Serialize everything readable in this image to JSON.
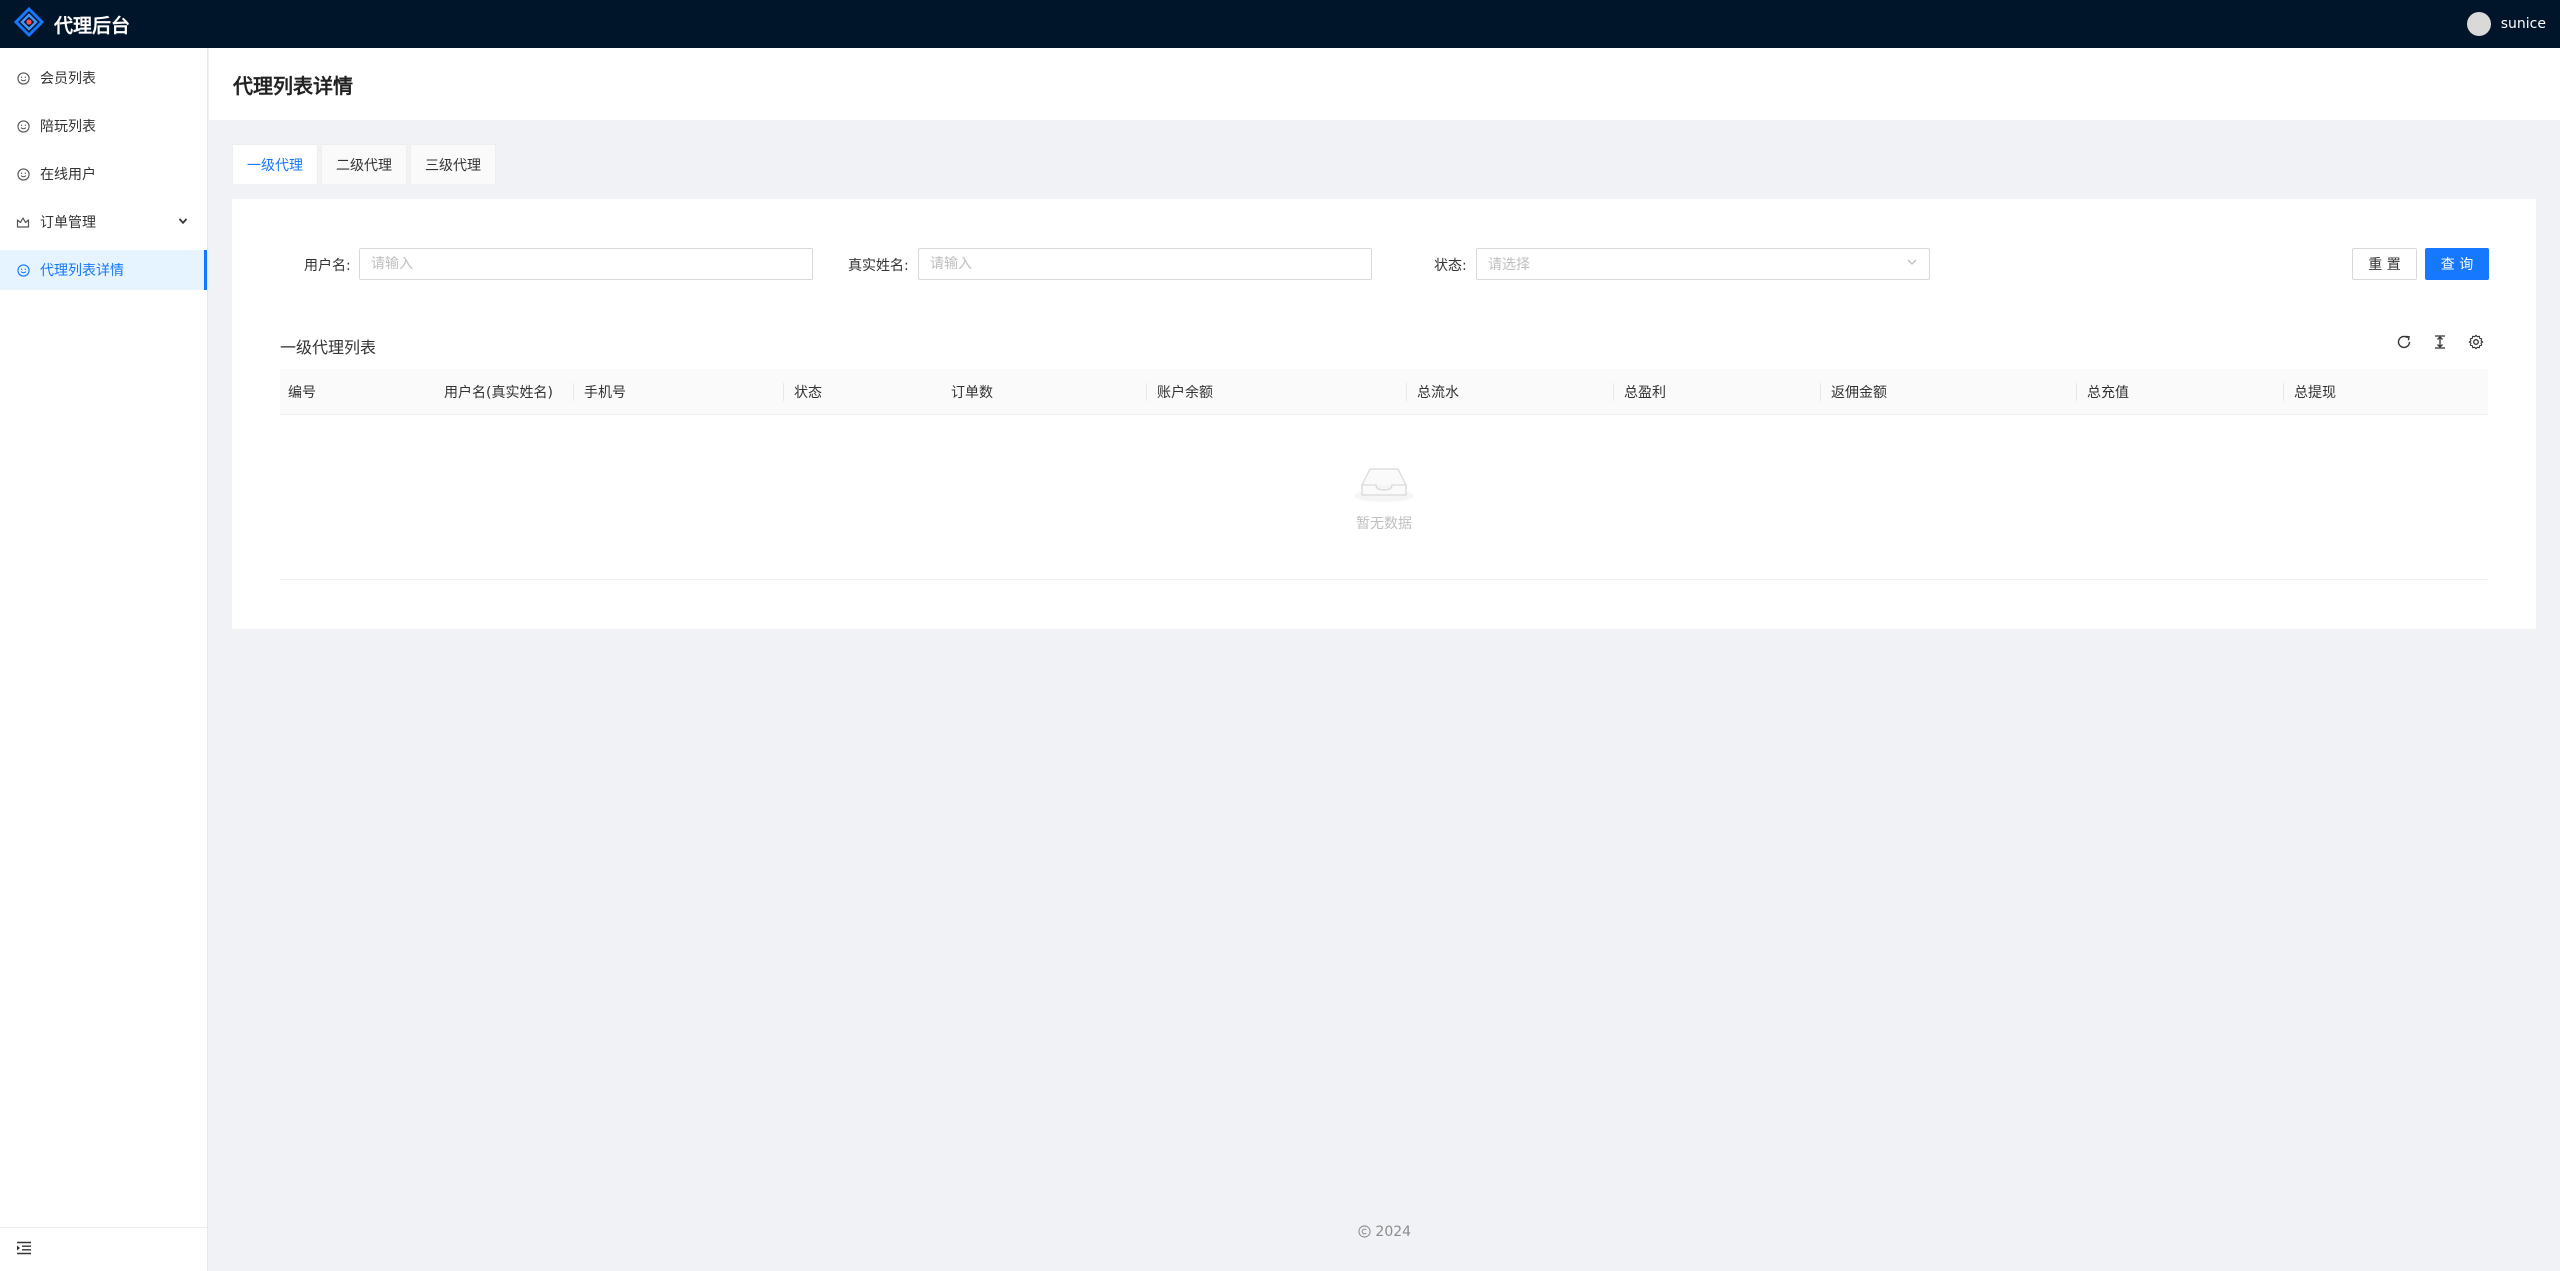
{
  "app": {
    "title": "代理后台"
  },
  "user": {
    "name": "sunice"
  },
  "sidebar": {
    "items": [
      {
        "label": "会员列表",
        "icon": "smile-icon"
      },
      {
        "label": "陪玩列表",
        "icon": "smile-icon"
      },
      {
        "label": "在线用户",
        "icon": "smile-icon"
      },
      {
        "label": "订单管理",
        "icon": "crown-icon"
      },
      {
        "label": "代理列表详情",
        "icon": "smile-icon",
        "active": true
      }
    ]
  },
  "page": {
    "title": "代理列表详情"
  },
  "tabs": [
    {
      "label": "一级代理",
      "active": true
    },
    {
      "label": "二级代理"
    },
    {
      "label": "三级代理"
    }
  ],
  "search": {
    "username_label": "用户名:",
    "username_placeholder": "请输入",
    "realname_label": "真实姓名:",
    "realname_placeholder": "请输入",
    "status_label": "状态:",
    "status_placeholder": "请选择",
    "reset_label": "重 置",
    "query_label": "查 询"
  },
  "table": {
    "title": "一级代理列表",
    "columns": [
      "编号",
      "用户名(真实姓名)",
      "手机号",
      "状态",
      "订单数",
      "账户余额",
      "总流水",
      "总盈利",
      "返佣金额",
      "总充值",
      "总提现"
    ],
    "empty_text": "暂无数据"
  },
  "footer": {
    "text": "2024"
  },
  "colors": {
    "primary": "#1677ff",
    "header_bg": "#001529"
  }
}
